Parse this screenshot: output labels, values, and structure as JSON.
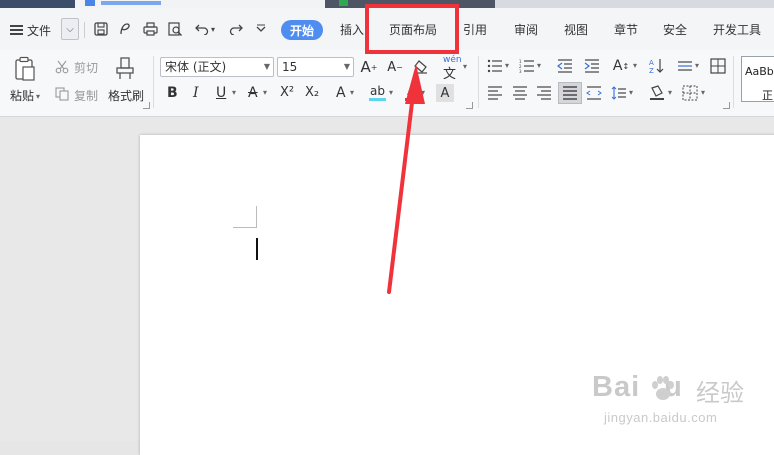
{
  "menu": {
    "file_label": "文件",
    "tabs": [
      {
        "label": "开始",
        "active": true
      },
      {
        "label": "插入"
      },
      {
        "label": "页面布局",
        "highlighted": true
      },
      {
        "label": "引用"
      },
      {
        "label": "审阅"
      },
      {
        "label": "视图"
      },
      {
        "label": "章节"
      },
      {
        "label": "安全"
      },
      {
        "label": "开发工具"
      }
    ]
  },
  "ribbon": {
    "clipboard": {
      "paste_label": "粘贴",
      "cut_label": "剪切",
      "copy_label": "复制",
      "format_painter_label": "格式刷"
    },
    "font": {
      "family_value": "宋体 (正文)",
      "size_value": "15",
      "pinyin_label": "wén",
      "bold_glyph": "B",
      "italic_glyph": "I",
      "underline_glyph": "U",
      "super_glyph": "X²",
      "sub_glyph": "X₂"
    },
    "styles": {
      "preview_text": "AaBb",
      "preview_name": "正"
    }
  },
  "annotation": {
    "highlight_color": "#f0333a"
  },
  "colors": {
    "accent": "#4f8df0",
    "annotation_red": "#f0333a"
  },
  "watermark": {
    "logo": "Bai",
    "logo_tail": "u",
    "cn": "经验",
    "url": "jingyan.baidu.com"
  }
}
